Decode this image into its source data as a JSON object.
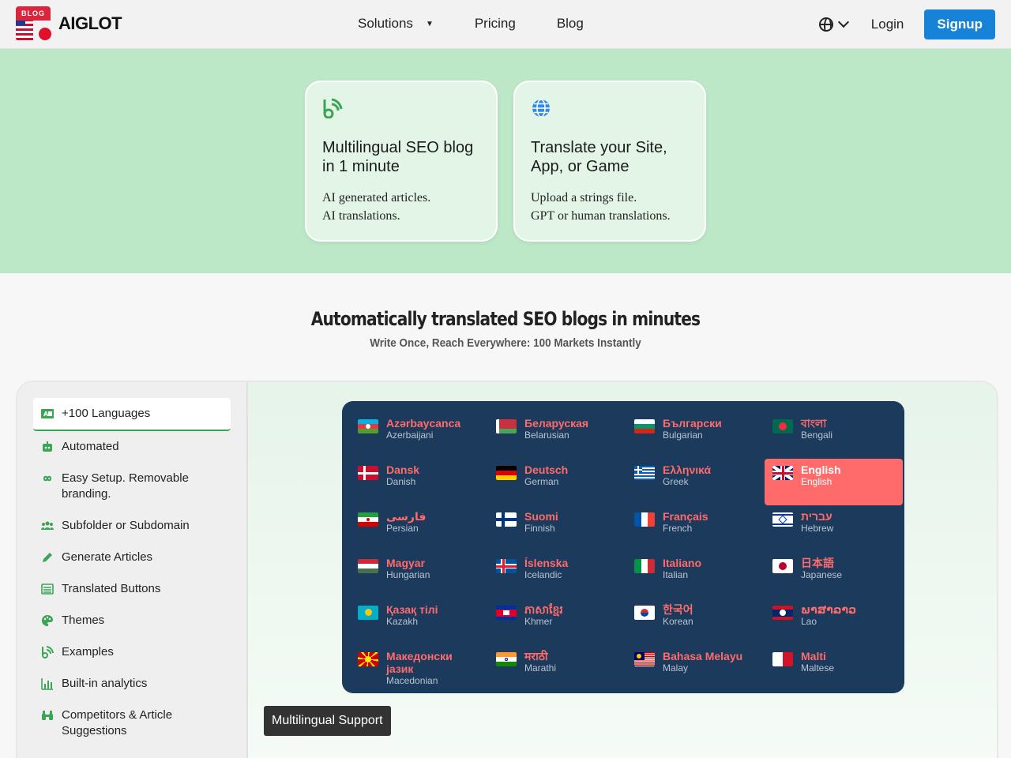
{
  "brand": {
    "tag": "BLOG",
    "name": "AIGLOT"
  },
  "nav": {
    "solutions": "Solutions",
    "pricing": "Pricing",
    "blog": "Blog"
  },
  "header": {
    "login": "Login",
    "signup": "Signup"
  },
  "cards": [
    {
      "title": "Multilingual SEO blog in 1 minute",
      "line1": "AI generated articles.",
      "line2": "AI translations."
    },
    {
      "title": "Translate your Site, App, or Game",
      "line1": "Upload a strings file.",
      "line2": "GPT or human translations."
    }
  ],
  "section": {
    "title": "Automatically translated SEO blogs in minutes",
    "subtitle": "Write Once, Reach Everywhere: 100 Markets Instantly"
  },
  "sidebar": [
    {
      "label": "+100 Languages",
      "icon": "translate-icon"
    },
    {
      "label": "Automated",
      "icon": "robot-icon"
    },
    {
      "label": "Easy Setup. Removable branding.",
      "icon": "infinity-icon"
    },
    {
      "label": "Subfolder or Subdomain",
      "icon": "users-icon"
    },
    {
      "label": "Generate Articles",
      "icon": "pencil-icon"
    },
    {
      "label": "Translated Buttons",
      "icon": "list-icon"
    },
    {
      "label": "Themes",
      "icon": "palette-icon"
    },
    {
      "label": "Examples",
      "icon": "blog-icon"
    },
    {
      "label": "Built-in analytics",
      "icon": "chart-icon"
    },
    {
      "label": "Competitors & Article Suggestions",
      "icon": "binoculars-icon"
    }
  ],
  "languages": [
    {
      "native": "Azərbaycanca",
      "english": "Azerbaijani",
      "flag": "az"
    },
    {
      "native": "Беларуская",
      "english": "Belarusian",
      "flag": "by"
    },
    {
      "native": "Български",
      "english": "Bulgarian",
      "flag": "bg"
    },
    {
      "native": "বাংলা",
      "english": "Bengali",
      "flag": "bd"
    },
    {
      "native": "Dansk",
      "english": "Danish",
      "flag": "dk"
    },
    {
      "native": "Deutsch",
      "english": "German",
      "flag": "de"
    },
    {
      "native": "Ελληνικά",
      "english": "Greek",
      "flag": "gr"
    },
    {
      "native": "English",
      "english": "English",
      "flag": "gb"
    },
    {
      "native": "فارسی",
      "english": "Persian",
      "flag": "ir"
    },
    {
      "native": "Suomi",
      "english": "Finnish",
      "flag": "fi"
    },
    {
      "native": "Français",
      "english": "French",
      "flag": "fr"
    },
    {
      "native": "עברית",
      "english": "Hebrew",
      "flag": "il"
    },
    {
      "native": "Magyar",
      "english": "Hungarian",
      "flag": "hu"
    },
    {
      "native": "Íslenska",
      "english": "Icelandic",
      "flag": "is"
    },
    {
      "native": "Italiano",
      "english": "Italian",
      "flag": "it"
    },
    {
      "native": "日本語",
      "english": "Japanese",
      "flag": "jp"
    },
    {
      "native": "Қазақ тілі",
      "english": "Kazakh",
      "flag": "kz"
    },
    {
      "native": "ភាសាខ្មែរ",
      "english": "Khmer",
      "flag": "kh"
    },
    {
      "native": "한국어",
      "english": "Korean",
      "flag": "kr"
    },
    {
      "native": "ພາສາລາວ",
      "english": "Lao",
      "flag": "la"
    },
    {
      "native": "Македонски јазик",
      "english": "Macedonian",
      "flag": "mk"
    },
    {
      "native": "मराठी",
      "english": "Marathi",
      "flag": "in"
    },
    {
      "native": "Bahasa Melayu",
      "english": "Malay",
      "flag": "my"
    },
    {
      "native": "Malti",
      "english": "Maltese",
      "flag": "mt"
    }
  ],
  "selected_language": "English",
  "tooltip": "Multilingual Support",
  "colors": {
    "accent": "#1683d8",
    "hero_bg": "#bce8c7",
    "grid_bg": "#1b3a5c",
    "highlight": "#ff6b6b",
    "green": "#3aa655"
  }
}
